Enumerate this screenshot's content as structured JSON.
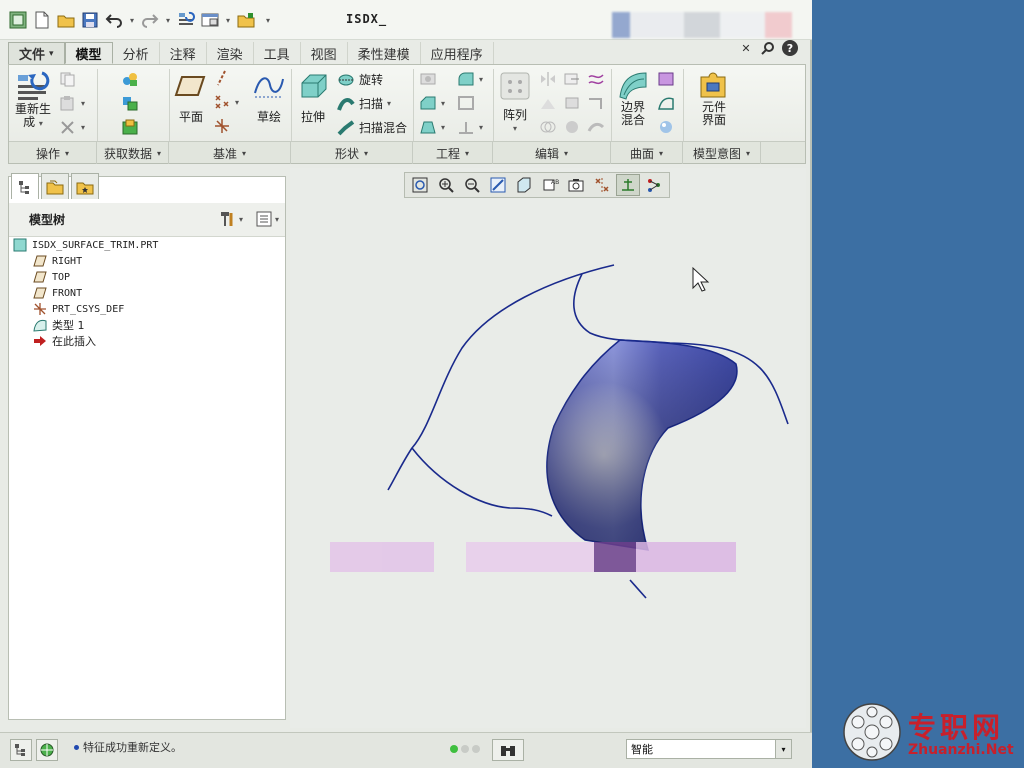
{
  "title": "ISDX_",
  "tabs": [
    {
      "label": "文件",
      "dropdown": "▾"
    },
    {
      "label": "模型"
    },
    {
      "label": "分析"
    },
    {
      "label": "注释"
    },
    {
      "label": "渲染"
    },
    {
      "label": "工具"
    },
    {
      "label": "视图"
    },
    {
      "label": "柔性建模"
    },
    {
      "label": "应用程序"
    }
  ],
  "ribbon": {
    "regenerate_line1": "重新生",
    "regenerate_line2": "成",
    "plane": "平面",
    "sketch": "草绘",
    "extrude": "拉伸",
    "revolve": "旋转",
    "sweep": "扫描",
    "swept_blend": "扫描混合",
    "pattern": "阵列",
    "boundary_line1": "边界",
    "boundary_line2": "混合",
    "component_line1": "元件",
    "component_line2": "界面",
    "groups": [
      "操作",
      "获取数据",
      "基准",
      "形状",
      "工程",
      "编辑",
      "曲面",
      "模型意图"
    ]
  },
  "model_tree": {
    "title": "模型树",
    "root": "ISDX_SURFACE_TRIM.PRT",
    "items": [
      {
        "label": "RIGHT",
        "icon": "datum-plane-icon"
      },
      {
        "label": "TOP",
        "icon": "datum-plane-icon"
      },
      {
        "label": "FRONT",
        "icon": "datum-plane-icon"
      },
      {
        "label": "PRT_CSYS_DEF",
        "icon": "csys-icon"
      },
      {
        "label": "类型 1",
        "icon": "style-feature-icon"
      },
      {
        "label": "在此插入",
        "icon": "insert-here-arrow-icon"
      }
    ]
  },
  "status": {
    "message": "特征成功重新定义。",
    "filter_value": "智能",
    "filter_arrow": "▾"
  },
  "watermark": {
    "cn": "专职网",
    "en": "Zhuanzhi.Net"
  },
  "colors": {
    "desktop": "#3c6fa3",
    "surface": "#5a66c4",
    "curve": "#1a2a8c",
    "watermark": "#c8202b"
  }
}
